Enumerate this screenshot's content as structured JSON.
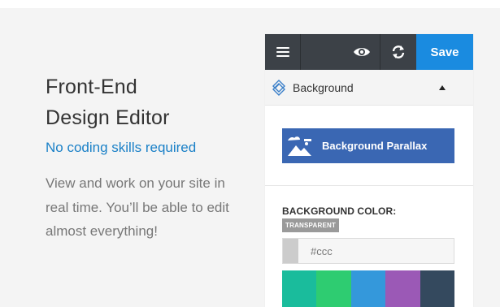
{
  "hero": {
    "title_line1": "Front-End",
    "title_line2": "Design Editor",
    "subtitle": "No coding skills required",
    "description": "View and work on your site in real time. You’ll be able to edit almost everything!"
  },
  "toolbar": {
    "menu_icon": "hamburger-icon",
    "preview_icon": "eye-icon",
    "refresh_icon": "refresh-icon",
    "save_label": "Save"
  },
  "section": {
    "icon": "layers-icon",
    "label": "Background",
    "caret_icon": "caret-up-icon"
  },
  "parallax": {
    "icon": "image-icon",
    "label": "Background Parallax"
  },
  "background_color": {
    "label": "BACKGROUND COLOR:",
    "badge": "TRANSPARENT",
    "current_color": "#cccccc",
    "hex_placeholder": "#ccc",
    "palette": [
      "#1abc9c",
      "#2ecc71",
      "#3498db",
      "#9b59b6",
      "#34495e"
    ]
  },
  "colors": {
    "accent": "#1a8be0",
    "subtitle": "#1a80c7",
    "toolbar": "#3c4147",
    "parallax_button": "#3a67b3"
  }
}
